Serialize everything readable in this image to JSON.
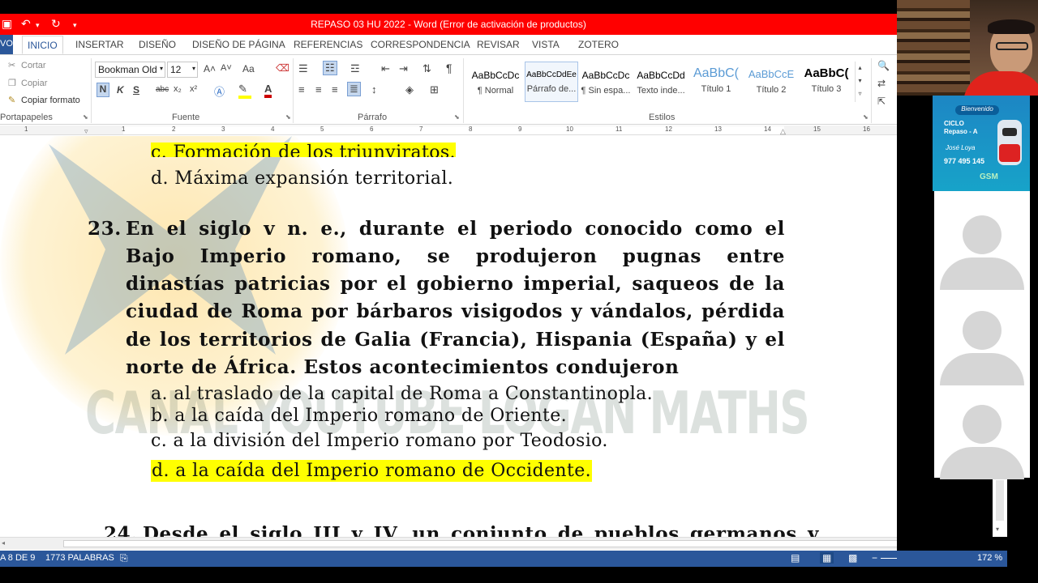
{
  "window": {
    "title": "REPASO 03 HU 2022 - Word (Error de activación de productos)"
  },
  "quick_access": {
    "save_icon": "save-icon",
    "undo_icon": "undo-icon",
    "redo_icon": "redo-icon"
  },
  "tabs": {
    "file": "VO",
    "items": [
      "INICIO",
      "INSERTAR",
      "DISEÑO",
      "DISEÑO DE PÁGINA",
      "REFERENCIAS",
      "CORRESPONDENCIA",
      "REVISAR",
      "VISTA",
      "ZOTERO"
    ]
  },
  "clipboard": {
    "cut": "Cortar",
    "copy": "Copiar",
    "format_painter": "Copiar formato",
    "label": "Portapapeles"
  },
  "font": {
    "name": "Bookman Old",
    "size": "12",
    "label": "Fuente",
    "bold": "N",
    "italic": "K",
    "underline": "S",
    "strike": "abc",
    "sub": "x₂",
    "sup": "x²",
    "grow": "A˄",
    "shrink": "A˅",
    "case": "Aa"
  },
  "paragraph": {
    "label": "Párrafo"
  },
  "styles": {
    "label": "Estilos",
    "items": [
      {
        "preview": "AaBbCcDc",
        "name": "¶ Normal"
      },
      {
        "preview": "AaBbCcDdEe",
        "name": "Párrafo de..."
      },
      {
        "preview": "AaBbCcDc",
        "name": "¶ Sin espa..."
      },
      {
        "preview": "AaBbCcDd",
        "name": "Texto inde..."
      },
      {
        "preview": "AaBbC(",
        "name": "Título 1"
      },
      {
        "preview": "AaBbCcE",
        "name": "Título 2"
      },
      {
        "preview": "AaBbC(",
        "name": "Título 3"
      }
    ]
  },
  "ruler": {
    "numbers": [
      "1",
      "1",
      "2",
      "3",
      "4",
      "5",
      "6",
      "7",
      "8",
      "9",
      "10",
      "11",
      "12",
      "13",
      "14",
      "15",
      "16"
    ]
  },
  "document": {
    "top_partial": "c. Formación de los triunviratos.",
    "top_option_d": "d. Máxima expansión territorial.",
    "q23_number": "23.",
    "q23_lines": [
      "En el siglo v n. e., durante el periodo conocido como el",
      "Bajo Imperio romano, se produjeron pugnas entre",
      "dinastías patricias por el gobierno imperial, saqueos de la",
      "ciudad de Roma por bárbaros visigodos y vándalos, pérdida",
      "de los territorios de Galia (Francia), Hispania (España) y el",
      "norte de África. Estos acontecimientos condujeron"
    ],
    "q23_options": [
      "a. al traslado de la capital de Roma a Constantinopla.",
      "b. a la caída del Imperio romano de Oriente.",
      "c. a la división del Imperio romano por Teodosio.",
      "d. a la caída del Imperio romano de Occidente."
    ],
    "q24_number": "24.",
    "q24_line": "Desde el siglo III y IV, un conjunto de pueblos germanos y",
    "watermark": "CANAL YOUTUBE LOGAN MATHS"
  },
  "status": {
    "page": "A 8 DE 9",
    "words": "1773 PALABRAS",
    "zoom": "172 %"
  },
  "banner": {
    "welcome": "Bienvenido",
    "line1": "CICLO",
    "line2": "Repaso - A",
    "teacher": "José Loya",
    "phone": "977 495 145",
    "brand": "GSM"
  }
}
